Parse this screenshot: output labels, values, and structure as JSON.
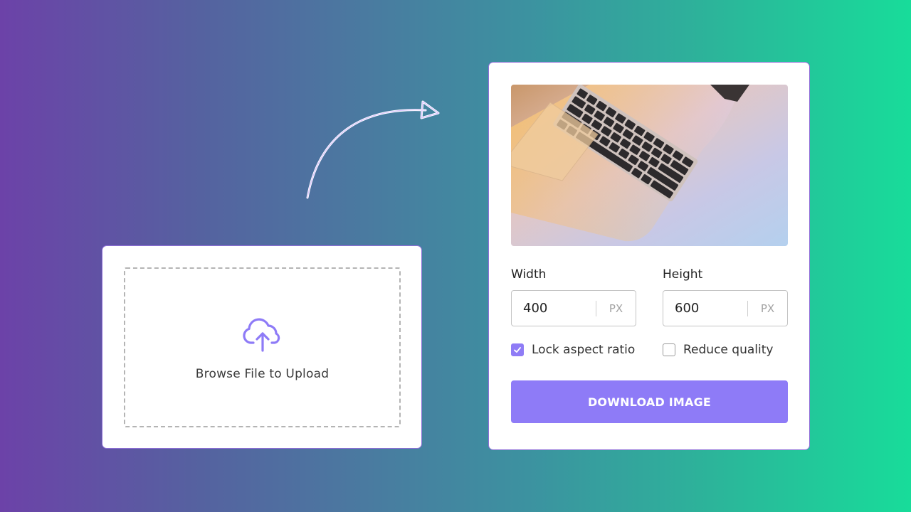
{
  "upload": {
    "label": "Browse File to Upload",
    "icon": "cloud-upload-icon",
    "accent_color": "#8e7bf7"
  },
  "preview": {
    "image_subject": "laptop-keyboard-image"
  },
  "width_field": {
    "label": "Width",
    "value": "400",
    "unit": "PX"
  },
  "height_field": {
    "label": "Height",
    "value": "600",
    "unit": "PX"
  },
  "options": {
    "lock_label": "Lock aspect ratio",
    "lock_checked": true,
    "quality_label": "Reduce quality",
    "quality_checked": false
  },
  "download": {
    "label": "DOWNLOAD IMAGE",
    "color": "#8e7bf7"
  },
  "colors": {
    "gradient_start": "#6c42a8",
    "gradient_end": "#18dc9a",
    "card_border": "#8f6fd8"
  }
}
